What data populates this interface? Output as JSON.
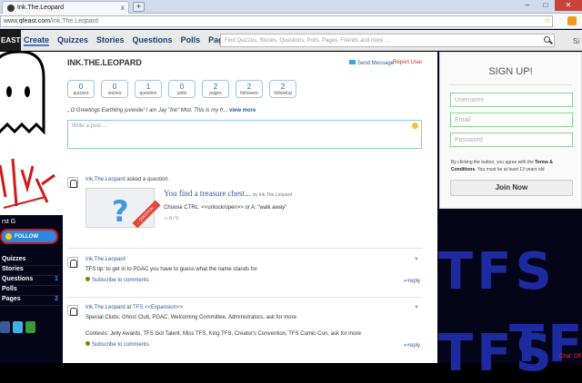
{
  "browser": {
    "tab_title": "Ink.The.Leopard",
    "tab_close": "x",
    "new_tab": "+",
    "url_domain": "qfeast.com",
    "url_path": "/Ink.The.Leopard",
    "url_prefix": "www."
  },
  "site": {
    "logo": "EAST",
    "nav": [
      "Create",
      "Quizzes",
      "Stories",
      "Questions",
      "Polls",
      "Pages"
    ],
    "search_placeholder": "Find Quizzes, Stories, Questions, Polls, Pages, Friends and more ...",
    "cut_link": "Si"
  },
  "left_panel": {
    "follow_label": "FOLLOW",
    "follower_label": "rst G",
    "stats": [
      {
        "label": "Quizzes",
        "count": ""
      },
      {
        "label": "Stories",
        "count": ""
      },
      {
        "label": "Questions",
        "count": "1"
      },
      {
        "label": "Polls",
        "count": ""
      },
      {
        "label": "Pages",
        "count": "2"
      }
    ]
  },
  "profile": {
    "name": "INK.THE.LEOPARD",
    "send_message": "Send Message",
    "report": "Report User",
    "stats": [
      {
        "n": "0",
        "label": "quizzes"
      },
      {
        "n": "0",
        "label": "stories"
      },
      {
        "n": "1",
        "label": "question"
      },
      {
        "n": "0",
        "label": "polls"
      },
      {
        "n": "2",
        "label": "pages"
      },
      {
        "n": "2",
        "label": "followers"
      },
      {
        "n": "2",
        "label": "following"
      }
    ],
    "bio": "„ Ω Greetings Earthling juvenile! I am Jay \"Ink\" Mist. This is my fr...",
    "bio_more": "view more",
    "post_placeholder": "Write a post...."
  },
  "feed": {
    "item1": {
      "user": "Ink.The.Leopard",
      "action": "asked a question",
      "q_title": "You find a treasure chest...",
      "q_by": "by Ink.The.Leopard",
      "q_ribbon": "QUESTION",
      "q_choose": "Choose CTRL: <<unlock/open>> or A: \"walk away\"",
      "q_meta": "0 / 0"
    },
    "item2": {
      "user": "Ink.The.Leopard",
      "text": "TFS tip: to get in to PGAC you have to guess what the name stands for",
      "subscribe": "Subscribe to comments",
      "reply": "reply"
    },
    "item3": {
      "user": "Ink.The.Leopard",
      "at": "at",
      "group": "TFS <<Expansion>>",
      "text1": "Special Clubs: Ghost Club, PGAC, Welcoming Committee, Administrators, ask for more",
      "text2": "Contests: Jelly Awards, TFS Got Talent, Miss TFS, King TFS, Creator's Convention, TFS Comic-Con, ask for more",
      "subscribe": "Subscribe to comments",
      "reply": "reply"
    }
  },
  "signup": {
    "title": "SIGN UP!",
    "username": "Username",
    "email": "Email",
    "password": "Password",
    "terms_pre": "By clicking the button, you agree with the",
    "terms_link1": "Terms &",
    "terms_link2": "Conditions",
    "terms_post": ". You must be at least 13 years old",
    "button": "Join Now"
  },
  "chat": "Chat: Off",
  "background_text": "TFS",
  "colors": {
    "accent": "#2d5aa1",
    "follow": "#2a88e0",
    "bg": "#05051a"
  }
}
